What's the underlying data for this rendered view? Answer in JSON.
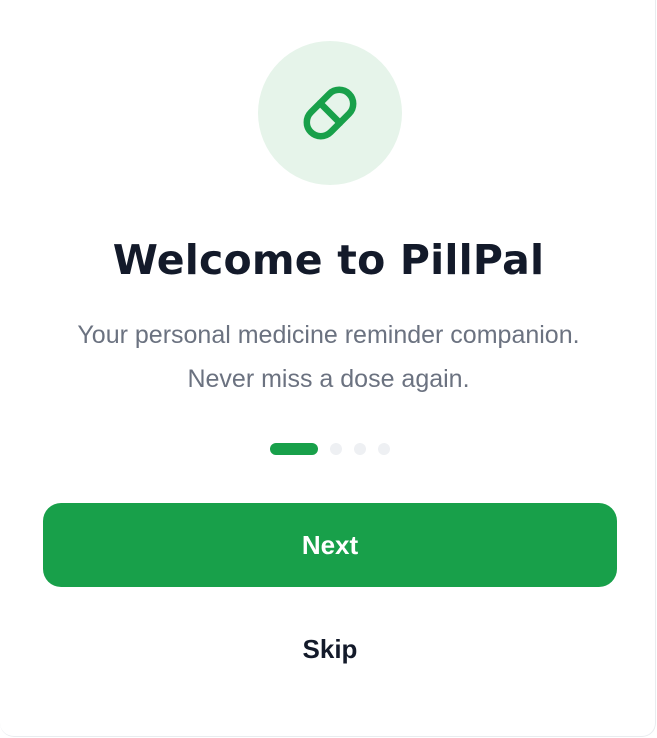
{
  "onboarding": {
    "icon": "pill-icon",
    "title": "Welcome to PillPal",
    "subtitle_line1": "Your personal medicine reminder companion.",
    "subtitle_line2": "Never miss a dose again.",
    "pagination": {
      "current_step": 1,
      "total_steps": 4
    },
    "next_label": "Next",
    "skip_label": "Skip"
  },
  "colors": {
    "accent": "#18a04a",
    "icon_background": "#e6f4ea",
    "title": "#131a2a",
    "subtitle": "#6b7280",
    "inactive_dot": "#eef0f3"
  }
}
